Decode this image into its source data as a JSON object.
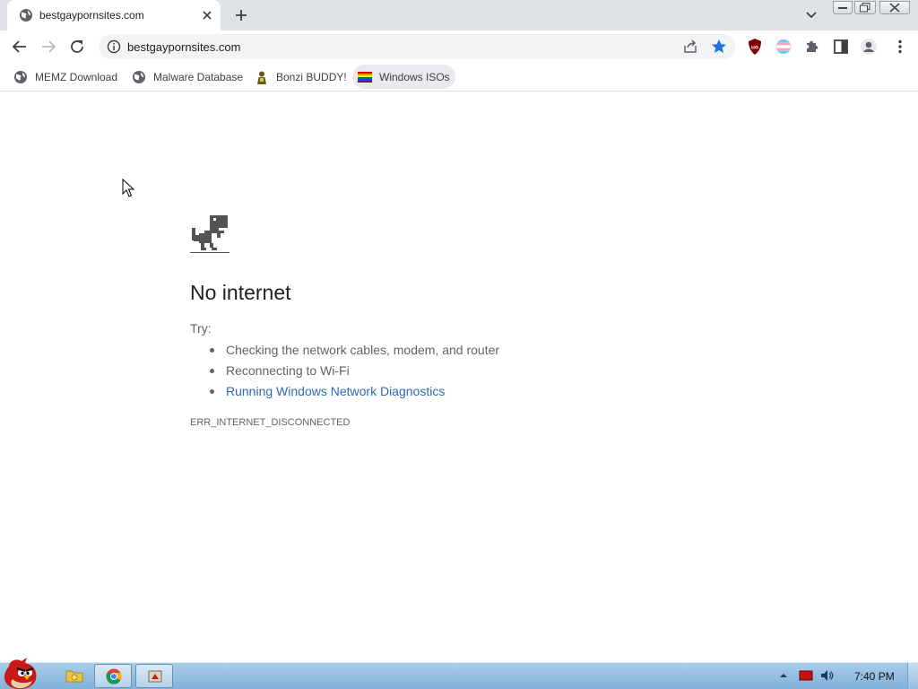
{
  "tab": {
    "title": "bestgaypornsites.com"
  },
  "omnibox": {
    "url": "bestgaypornsites.com"
  },
  "bookmarks": [
    {
      "label": "MEMZ Download",
      "icon": "globe-icon"
    },
    {
      "label": "Malware Database",
      "icon": "globe-icon"
    },
    {
      "label": "Bonzi BUDDY!",
      "icon": "bonzi-icon"
    },
    {
      "label": "Windows ISOs",
      "icon": "rainbow-flag-icon"
    }
  ],
  "error_page": {
    "title": "No internet",
    "try_label": "Try:",
    "suggestions": [
      "Checking the network cables, modem, and router",
      "Reconnecting to Wi-Fi",
      "Running Windows Network Diagnostics"
    ],
    "code": "ERR_INTERNET_DISCONNECTED"
  },
  "taskbar": {
    "clock": "7:40 PM"
  },
  "colors": {
    "accent": "#1a73e8",
    "tabstrip": "#dee1e6",
    "taskbar": "#8fbde3"
  }
}
